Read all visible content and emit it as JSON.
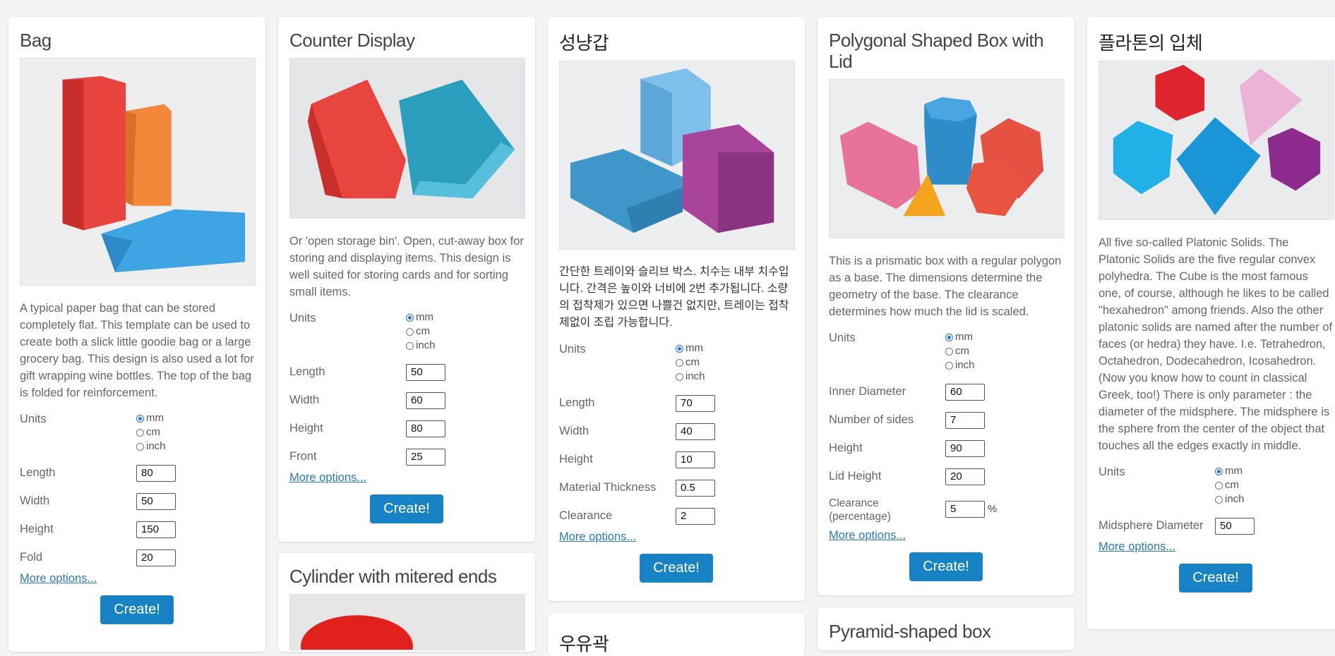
{
  "common": {
    "units_label": "Units",
    "unit_options": [
      "mm",
      "cm",
      "inch"
    ],
    "more_options": "More options...",
    "create": "Create!"
  },
  "cards": {
    "bag": {
      "title": "Bag",
      "description": "A typical paper bag that can be stored completely flat. This template can be used to create both a slick little goodie bag or a large grocery bag. This design is also used a lot for gift wrapping wine bottles. The top of the bag is folded for reinforcement.",
      "fields": [
        {
          "label": "Length",
          "value": "80"
        },
        {
          "label": "Width",
          "value": "50"
        },
        {
          "label": "Height",
          "value": "150"
        },
        {
          "label": "Fold",
          "value": "20"
        }
      ]
    },
    "counter": {
      "title": "Counter Display",
      "description": "Or 'open storage bin'. Open, cut-away box for storing and displaying items. This design is well suited for storing cards and for sorting small items.",
      "fields": [
        {
          "label": "Length",
          "value": "50"
        },
        {
          "label": "Width",
          "value": "60"
        },
        {
          "label": "Height",
          "value": "80"
        },
        {
          "label": "Front",
          "value": "25"
        }
      ]
    },
    "cylinder": {
      "title": "Cylinder with mitered ends"
    },
    "matchbox": {
      "title": "성냥갑",
      "description": "간단한 트레이와 슬리브 박스. 치수는 내부 치수입니다. 간격은 높이와 너비에 2번 추가됩니다. 소량의 접착제가 있으면 나쁠건 없지만, 트레이는 접착제없이 조립 가능합니다.",
      "fields": [
        {
          "label": "Length",
          "value": "70"
        },
        {
          "label": "Width",
          "value": "40"
        },
        {
          "label": "Height",
          "value": "10"
        },
        {
          "label": "Material Thickness",
          "value": "0.5"
        },
        {
          "label": "Clearance",
          "value": "2"
        }
      ]
    },
    "next_korean": {
      "title": "우유곽"
    },
    "polygonal": {
      "title": "Polygonal Shaped Box with Lid",
      "description": "This is a prismatic box with a regular polygon as a base. The dimensions determine the geometry of the base. The clearance determines how much the lid is scaled.",
      "fields": [
        {
          "label": "Inner Diameter",
          "value": "60"
        },
        {
          "label": "Number of sides",
          "value": "7"
        },
        {
          "label": "Height",
          "value": "90"
        },
        {
          "label": "Lid Height",
          "value": "20"
        }
      ],
      "clearance_label": "Clearance (percentage)",
      "clearance_value": "5",
      "percent": "%"
    },
    "pyramid": {
      "title": "Pyramid-shaped box"
    },
    "platonic": {
      "title": "플라톤의 입체",
      "description": "All five so-called Platonic Solids. The Platonic Solids are the five regular convex polyhedra. The Cube is the most famous one, of course, although he likes to be called \"hexahedron\" among friends. Also the other platonic solids are named after the number of faces (or hedra) they have. I.e. Tetrahedron, Octahedron, Dodecahedron, Icosahedron. (Now you know how to count in classical Greek, too!) There is only parameter : the diameter of the midsphere. The midsphere is the sphere from the center of the object that touches all the edges exactly in middle.",
      "fields": [
        {
          "label": "Midsphere Diameter",
          "value": "50"
        }
      ]
    }
  }
}
